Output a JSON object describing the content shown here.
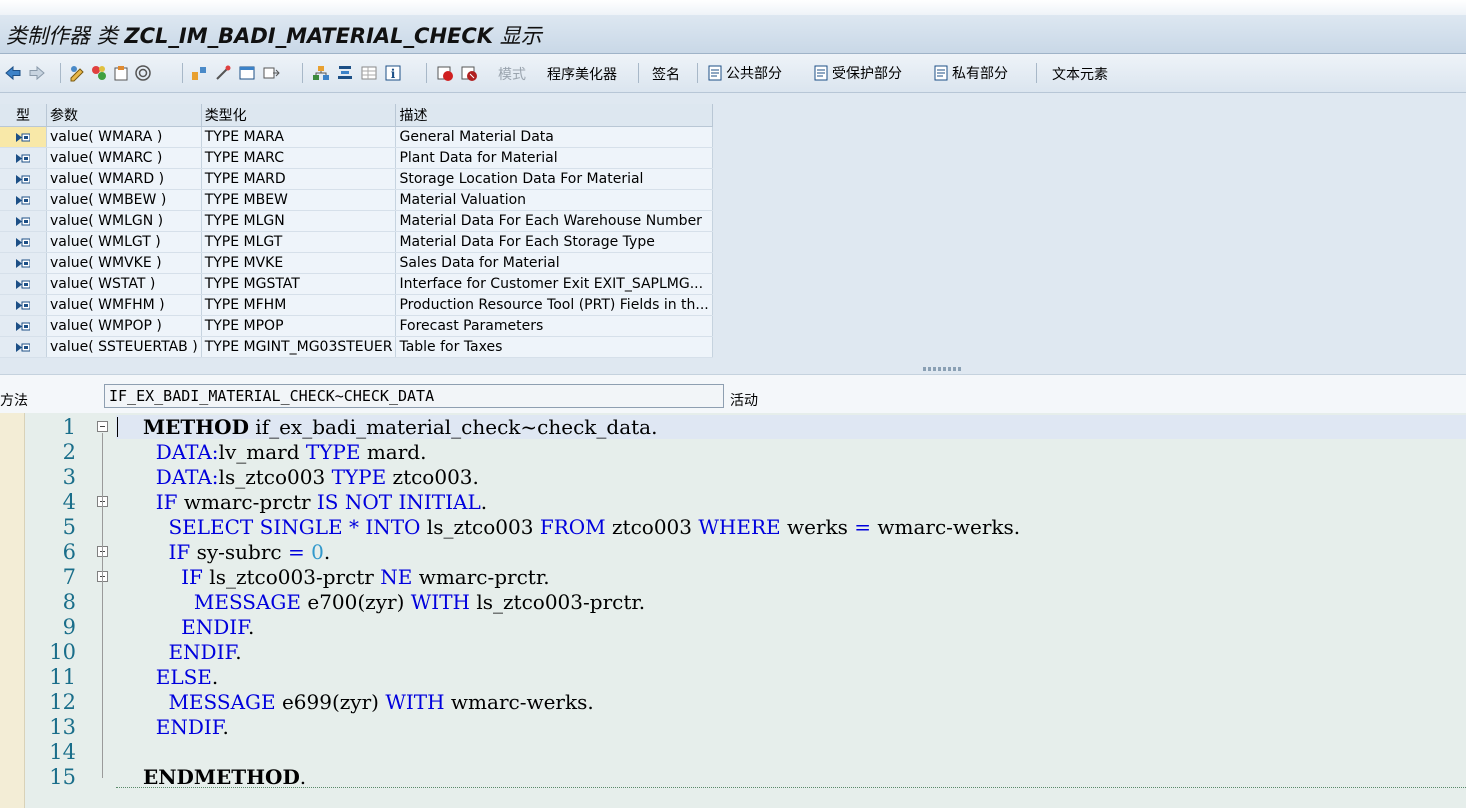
{
  "title": {
    "prefix": "类制作器 类",
    "class_name": "ZCL_IM_BADI_MATERIAL_CHECK",
    "suffix": "显示"
  },
  "toolbar": {
    "icons": [
      "back-icon",
      "forward-icon",
      "toggle-edit-icon",
      "check-icon",
      "activate-icon",
      "test-icon",
      "where-used-icon",
      "object-list-icon",
      "navigation-window-icon",
      "tree-icon",
      "hierarchy-icon",
      "grid-icon",
      "info-icon",
      "breakpoint-icon",
      "session-breakpoint-icon"
    ],
    "mode_label": "模式",
    "pretty_printer_label": "程序美化器",
    "signature_label": "签名",
    "public_section_label": "公共部分",
    "protected_section_label": "受保护部分",
    "private_section_label": "私有部分",
    "text_elements_label": "文本元素"
  },
  "params": {
    "headers": [
      "型",
      "参数",
      "类型化",
      "描述"
    ],
    "rows": [
      {
        "param": "value( WMARA )",
        "typing": "TYPE MARA",
        "desc": "General Material Data"
      },
      {
        "param": "value( WMARC )",
        "typing": "TYPE MARC",
        "desc": "Plant Data for Material"
      },
      {
        "param": "value( WMARD )",
        "typing": "TYPE MARD",
        "desc": "Storage Location Data For Material"
      },
      {
        "param": "value( WMBEW )",
        "typing": "TYPE MBEW",
        "desc": "Material Valuation"
      },
      {
        "param": "value( WMLGN )",
        "typing": "TYPE MLGN",
        "desc": "Material Data For Each Warehouse Number"
      },
      {
        "param": "value( WMLGT )",
        "typing": "TYPE MLGT",
        "desc": "Material Data For Each Storage Type"
      },
      {
        "param": "value( WMVKE )",
        "typing": "TYPE MVKE",
        "desc": "Sales Data for Material"
      },
      {
        "param": "value( WSTAT )",
        "typing": "TYPE MGSTAT",
        "desc": "Interface for Customer Exit EXIT_SAPLMG..."
      },
      {
        "param": "value( WMFHM )",
        "typing": "TYPE MFHM",
        "desc": "Production Resource Tool (PRT) Fields in th..."
      },
      {
        "param": "value( WMPOP )",
        "typing": "TYPE MPOP",
        "desc": "Forecast Parameters"
      },
      {
        "param": "value( SSTEUERTAB )",
        "typing": "TYPE MGINT_MG03STEUER",
        "desc": "Table for Taxes"
      }
    ]
  },
  "method": {
    "label": "方法",
    "value": "IF_EX_BADI_MATERIAL_CHECK~CHECK_DATA",
    "status": "活动"
  },
  "editor": {
    "line_numbers": [
      "1",
      "2",
      "3",
      "4",
      "5",
      "6",
      "7",
      "8",
      "9",
      "10",
      "11",
      "12",
      "13",
      "14",
      "15"
    ],
    "lines": [
      "METHOD if_ex_badi_material_check~check_data.",
      "  DATA:lv_mard TYPE mard.",
      "  DATA:ls_ztco003 TYPE ztco003.",
      "  IF wmarc-prctr IS NOT INITIAL.",
      "    SELECT SINGLE * INTO ls_ztco003 FROM ztco003 WHERE werks = wmarc-werks.",
      "    IF sy-subrc = 0.",
      "      IF ls_ztco003-prctr NE wmarc-prctr.",
      "        MESSAGE e700(zyr) WITH ls_ztco003-prctr.",
      "      ENDIF.",
      "    ENDIF.",
      "  ELSE.",
      "    MESSAGE e699(zyr) WITH wmarc-werks.",
      "  ENDIF.",
      "",
      "ENDMETHOD."
    ]
  },
  "colors": {
    "keyword": "#0000dd",
    "number": "#3399cc",
    "line_number": "#1a6e8a",
    "selected_row": "#f8e8a8"
  }
}
